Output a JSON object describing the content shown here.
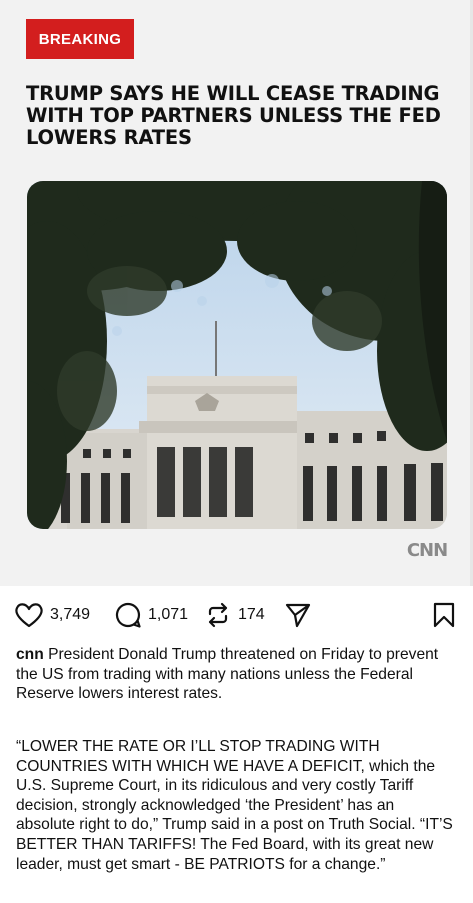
{
  "post": {
    "tag": "BREAKING",
    "headline": "TRUMP SAYS HE WILL CEASE TRADING WITH TOP PARTNERS UNLESS THE FED LOWERS RATES",
    "image_alt": "Federal Reserve building framed by trees",
    "source_logo": "CNN"
  },
  "actions": {
    "likes": "3,749",
    "comments": "1,071",
    "reposts": "174"
  },
  "caption": {
    "username": "cnn",
    "lead": "President Donald Trump threatened on Friday to prevent the US from trading with many nations unless the Federal Reserve lowers interest rates.",
    "body": "“LOWER THE RATE OR I’LL STOP TRADING WITH COUNTRIES WITH WHICH WE HAVE A DEFICIT, which the U.S. Supreme Court, in its ridiculous and very costly Tariff decision, strongly acknowledged ‘the President’ has an absolute right to do,” Trump said in a post on Truth Social. “IT’S BETTER THAN TARIFFS! The Fed Board, with its great new leader, must get smart - BE PATRIOTS for a change.”"
  },
  "colors": {
    "breaking_red": "#d31e1e",
    "card_background": "#f2f2f2"
  }
}
